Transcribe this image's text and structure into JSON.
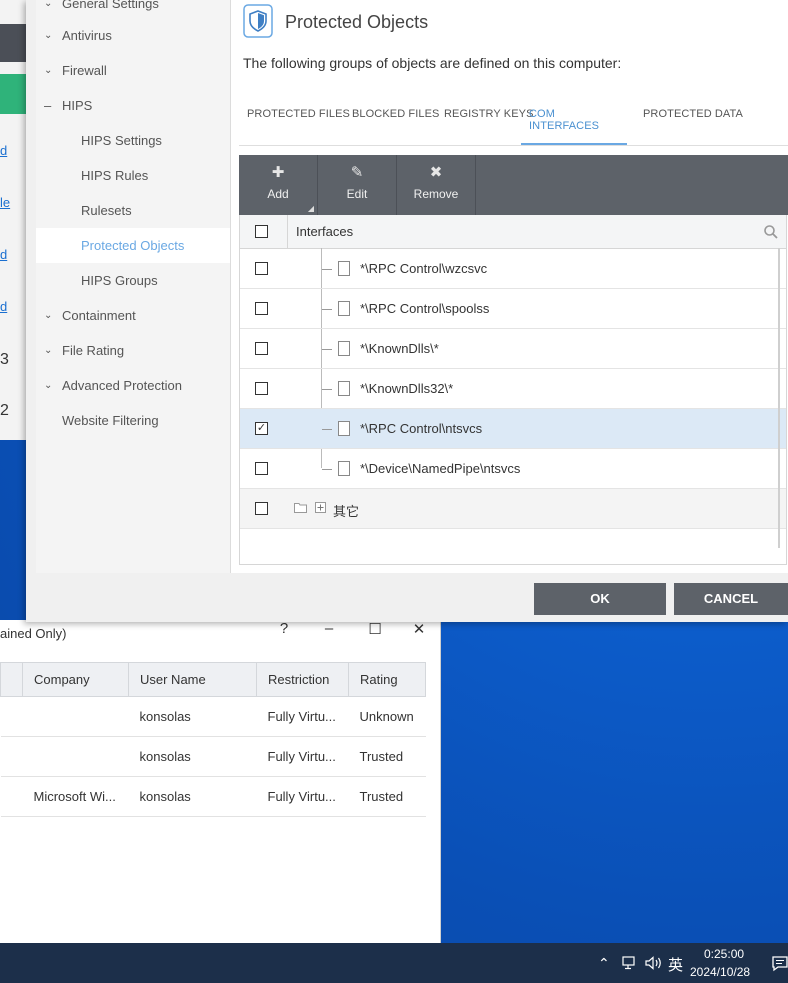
{
  "left_window": {
    "links": [
      "d",
      "le",
      "d",
      "d"
    ],
    "numbers": [
      "3",
      "2"
    ]
  },
  "bottom_window": {
    "title": "ained Only)",
    "controls": [
      "?",
      "–",
      "☐",
      "✕"
    ],
    "columns": [
      "Company",
      "User Name",
      "Restriction",
      "Rating"
    ],
    "rows": [
      {
        "company": "",
        "user": "konsolas",
        "restriction": "Fully Virtu...",
        "rating": "Unknown"
      },
      {
        "company": "",
        "user": "konsolas",
        "restriction": "Fully Virtu...",
        "rating": "Trusted"
      },
      {
        "company": "Microsoft Wi...",
        "user": "konsolas",
        "restriction": "Fully Virtu...",
        "rating": "Trusted"
      }
    ]
  },
  "nav": {
    "items": [
      {
        "label": "General Settings",
        "kind": "section"
      },
      {
        "label": "Antivirus",
        "kind": "section"
      },
      {
        "label": "Firewall",
        "kind": "section"
      },
      {
        "label": "HIPS",
        "kind": "expanded"
      },
      {
        "label": "HIPS Settings",
        "kind": "sub"
      },
      {
        "label": "HIPS Rules",
        "kind": "sub"
      },
      {
        "label": "Rulesets",
        "kind": "sub"
      },
      {
        "label": "Protected Objects",
        "kind": "active"
      },
      {
        "label": "HIPS Groups",
        "kind": "sub"
      },
      {
        "label": "Containment",
        "kind": "section"
      },
      {
        "label": "File Rating",
        "kind": "section"
      },
      {
        "label": "Advanced Protection",
        "kind": "section"
      },
      {
        "label": "Website Filtering",
        "kind": "plain"
      }
    ]
  },
  "panel": {
    "title": "Protected Objects",
    "description": "The following groups of objects are defined on this computer:",
    "tabs": [
      "PROTECTED FILES",
      "BLOCKED FILES",
      "REGISTRY KEYS",
      "COM INTERFACES",
      "PROTECTED DATA"
    ],
    "active_tab": "COM INTERFACES",
    "toolbar": {
      "add": "Add",
      "edit": "Edit",
      "remove": "Remove"
    },
    "list_header": "Interfaces",
    "rows": [
      {
        "text": "*\\RPC Control\\wzcsvc",
        "checked": false
      },
      {
        "text": "*\\RPC Control\\spoolss",
        "checked": false
      },
      {
        "text": "*\\KnownDlls\\*",
        "checked": false
      },
      {
        "text": "*\\KnownDlls32\\*",
        "checked": false
      },
      {
        "text": "*\\RPC Control\\ntsvcs",
        "checked": true
      },
      {
        "text": "*\\Device\\NamedPipe\\ntsvcs",
        "checked": false
      }
    ],
    "group_row": "其它"
  },
  "buttons": {
    "ok": "OK",
    "cancel": "CANCEL"
  },
  "taskbar": {
    "ime": "英",
    "time": "0:25:00",
    "date": "2024/10/28"
  },
  "colors": {
    "accent": "#6aa8e3",
    "toolbar": "#5d6269",
    "taskbar": "#1c2f4a"
  }
}
